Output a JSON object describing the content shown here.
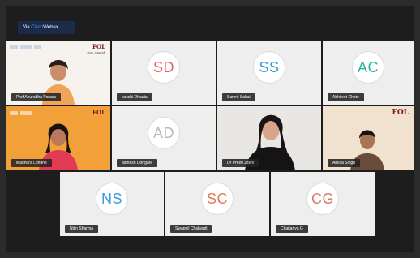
{
  "app": {
    "badge_prefix": "Via ",
    "badge_accent": "Cisco",
    "badge_suffix": "Webex",
    "accent_color": "#3aa6ff"
  },
  "participants": [
    {
      "name": "Prof Anuradha Patasa",
      "initials": "",
      "video": true
    },
    {
      "name": "sakshi Dhauta",
      "initials": "SD",
      "color": "#e06a6a"
    },
    {
      "name": "Samrit Sahai",
      "initials": "SS",
      "color": "#3a9cd8"
    },
    {
      "name": "Abhijeet Chote",
      "initials": "AC",
      "color": "#2bb3a3"
    },
    {
      "name": "Madhura Londhe",
      "initials": "",
      "video": true
    },
    {
      "name": "adinesh Dongare",
      "initials": "AD",
      "color": "#b9b9b9"
    },
    {
      "name": "Dr Preeti Joshi",
      "initials": "",
      "video": true
    },
    {
      "name": "Ankita Singh",
      "initials": "",
      "video": true
    },
    {
      "name": "Nitin Sharma",
      "initials": "NS",
      "color": "#3a9cd8"
    },
    {
      "name": "Swapnil Chalwadi",
      "initials": "SC",
      "color": "#e07c5a"
    },
    {
      "name": "Chaitanya G",
      "initials": "CG",
      "color": "#d97a6a"
    }
  ],
  "logo_text": "FOL",
  "logo_sub": "शाळा  अमरावती"
}
